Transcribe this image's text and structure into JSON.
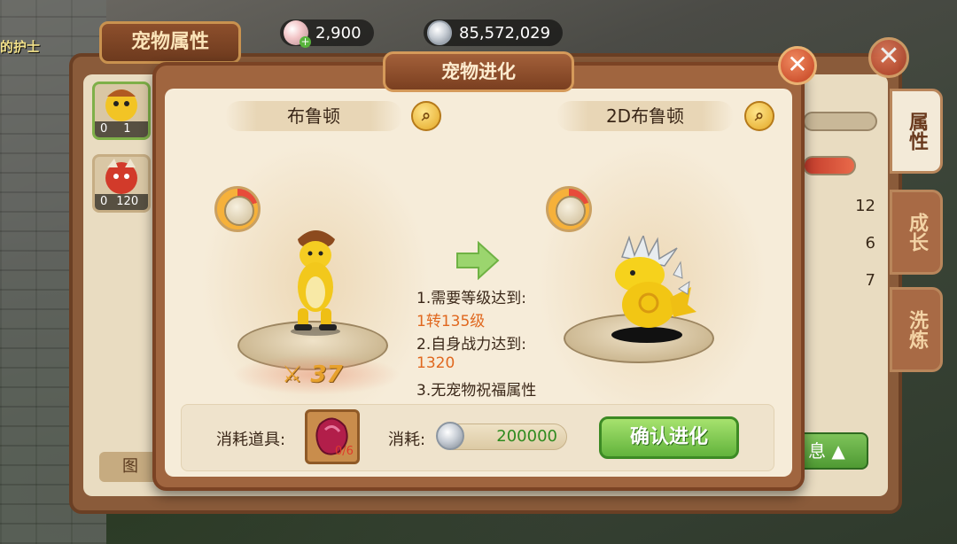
{
  "background": {
    "npc_name": "的护士",
    "panel_title": "宠物属性",
    "close_icon": "close-icon",
    "pets": [
      {
        "level_left": "0",
        "level_right": "1"
      },
      {
        "level_left": "0",
        "level_right": "120"
      }
    ],
    "tabs": [
      "属性",
      "成长",
      "洗炼"
    ],
    "stats": [
      "12",
      "6",
      "7"
    ],
    "info_button": "息",
    "tu_button": "图"
  },
  "currency": {
    "gems": "2,900",
    "coins": "85,572,029"
  },
  "modal": {
    "title": "宠物进化",
    "close_icon": "close-icon",
    "from_pet": {
      "name": "布鲁顿",
      "power": "37"
    },
    "to_pet": {
      "name": "2D布鲁顿"
    },
    "requirements": {
      "line1": "1.需要等级达到:",
      "line1_value": "1转135级",
      "line2": "2.自身战力达到:",
      "line2_value": "1320",
      "line3": "3.无宠物祝福属性"
    },
    "consume_item_label": "消耗道具:",
    "item_count": "0/6",
    "consume_label": "消耗:",
    "consume_value": "200000",
    "confirm_button": "确认进化"
  }
}
